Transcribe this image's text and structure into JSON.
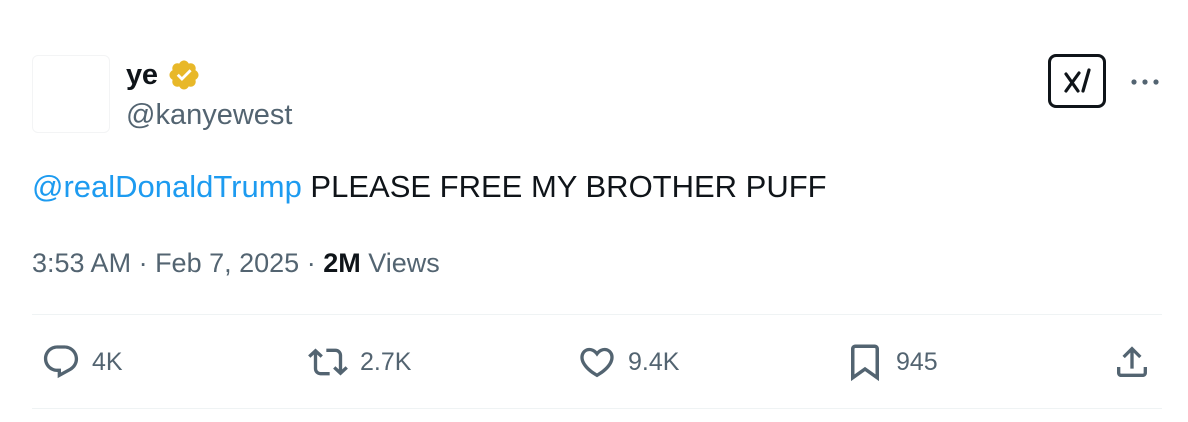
{
  "user": {
    "display_name": "ye",
    "handle": "@kanyewest",
    "verified_badge_color": "#e8b829"
  },
  "tweet": {
    "mention": "@realDonaldTrump",
    "text": " PLEASE FREE MY BROTHER PUFF",
    "time": "3:53 AM",
    "separator1": " · ",
    "date": "Feb 7, 2025",
    "separator2": " · ",
    "views_count": "2M",
    "views_label": " Views"
  },
  "actions": {
    "reply_count": "4K",
    "repost_count": "2.7K",
    "like_count": "9.4K",
    "bookmark_count": "945"
  },
  "colors": {
    "text": "#0f1419",
    "secondary": "#536471",
    "link": "#1d9bf0",
    "divider": "#eff3f4"
  },
  "icons": {
    "grok": "grok-icon",
    "more": "more-icon",
    "reply": "reply-icon",
    "repost": "repost-icon",
    "like": "heart-icon",
    "bookmark": "bookmark-icon",
    "share": "share-icon",
    "verified": "verified-badge-icon"
  }
}
